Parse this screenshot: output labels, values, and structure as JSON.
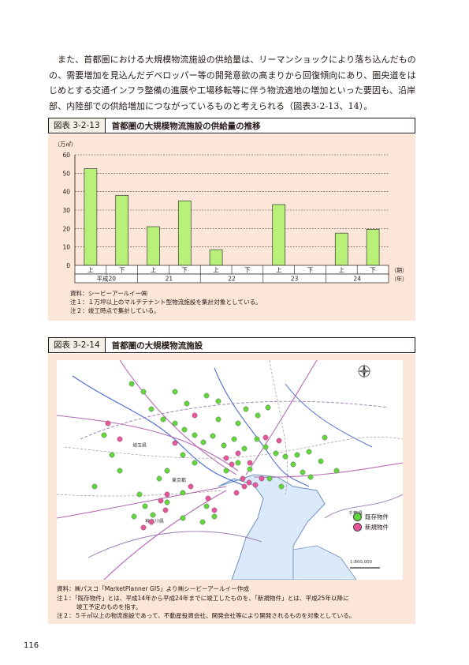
{
  "paragraph": "また、首都圏における大規模物流施設の供給量は、リーマンショックにより落ち込んだものの、需要増加を見込んだデベロッパー等の開発意欲の高まりから回復傾向にあり、圏央道をはじめとする交通インフラ整備の進展や工場移転等に伴う物流適地の増加といった要因も、沿岸部、内陸部での供給増加につながっているものと考えられる（図表3-2-13、14）。",
  "figure1": {
    "number": "図表 3-2-13",
    "title": "首都圏の大規模物流施設の供給量の推移",
    "notes": [
      "資料：シービーアールイー㈱",
      "注１：１万坪以上のマルチテナント型物流施設を集計対象としている。",
      "注２：竣工時点で集計している。"
    ]
  },
  "chart_data": {
    "type": "bar",
    "unit_label": "（万㎡）",
    "ylim": [
      0,
      60
    ],
    "yticks": [
      "0",
      "10",
      "20",
      "30",
      "40",
      "50",
      "60"
    ],
    "grid": "dashed horizontal",
    "categories": [
      "上",
      "下",
      "上",
      "下",
      "上",
      "下",
      "上",
      "下",
      "上",
      "下"
    ],
    "year_labels": [
      "平成20",
      "21",
      "22",
      "23",
      "24"
    ],
    "period_axis_label": "（期）",
    "year_axis_label": "（年）",
    "values": [
      52.5,
      38,
      21,
      35,
      8.5,
      0,
      33,
      0,
      17.5,
      19.5
    ],
    "colors": {
      "bar": "#b8f07a",
      "bar_border": "#3a3a3a",
      "background": "#fbe6d8"
    }
  },
  "figure2": {
    "number": "図表 3-2-14",
    "title": "首都圏の大規模物流施設",
    "legend": [
      {
        "label": "既存物件",
        "color": "#63d63c"
      },
      {
        "label": "新規物件",
        "color": "#e8569a"
      }
    ],
    "place_labels": [
      "埼玉県",
      "東京都",
      "千葉県",
      "神奈川県"
    ],
    "scale_text": "1:800,000",
    "notes": [
      "資料：㈱パスコ「MarketPlanner GIS」より㈱シービーアールイー作成",
      "注１：「既存物件」とは、平成14年から平成24年までに竣工したものを、「新規物件」とは、平成25年以降に",
      "竣工予定のものを指す。",
      "注２：５千㎡以上の物流施設であって、不動産投資会社、開発会社等により開発されるものを対象としている。"
    ]
  },
  "page_number": "116"
}
